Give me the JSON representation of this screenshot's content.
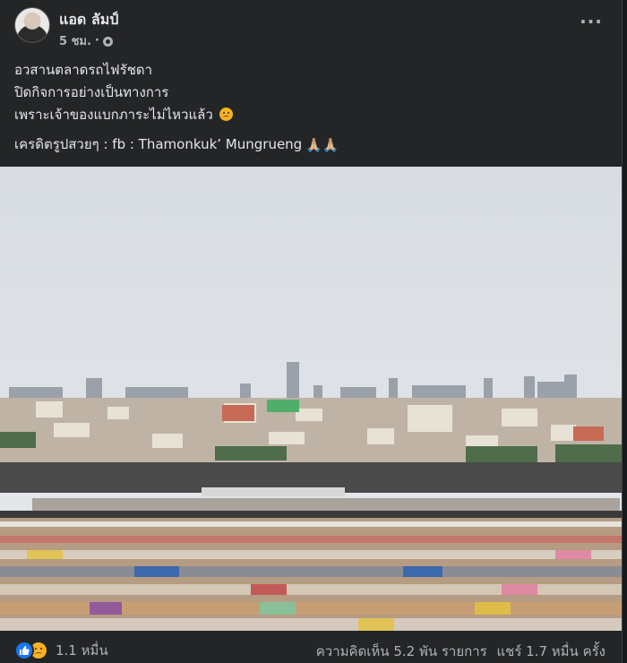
{
  "post": {
    "author": "แอด ลัมป์",
    "time": "5 ชม.",
    "time_separator": "·",
    "privacy_icon": "globe-icon",
    "more_icon": "more-horizontal-icon",
    "more_glyph": "···",
    "lines": [
      "อวสานตลาดรถไฟรัชดา",
      "ปิดกิจการอย่างเป็นทางการ",
      "เพราะเจ้าของแบกภาระไม่ไหวแล้ว"
    ],
    "credit": "เครดิตรูปสวยๆ : fb : Thamonkuk’ Mungrueng",
    "pray_glyph": "🙏🏼🙏🏼"
  },
  "photo": {
    "description_icon": "market-rooftop-photo",
    "sky_color": "#dfe3e8",
    "city_color": "#b9a89a"
  },
  "footer": {
    "reaction_icons": [
      "like-icon",
      "sad-icon"
    ],
    "reaction_count": "1.1 หมื่น",
    "comments": "ความคิดเห็น 5.2 พัน รายการ",
    "shares": "แชร์ 1.7 หมื่น ครั้ง"
  }
}
